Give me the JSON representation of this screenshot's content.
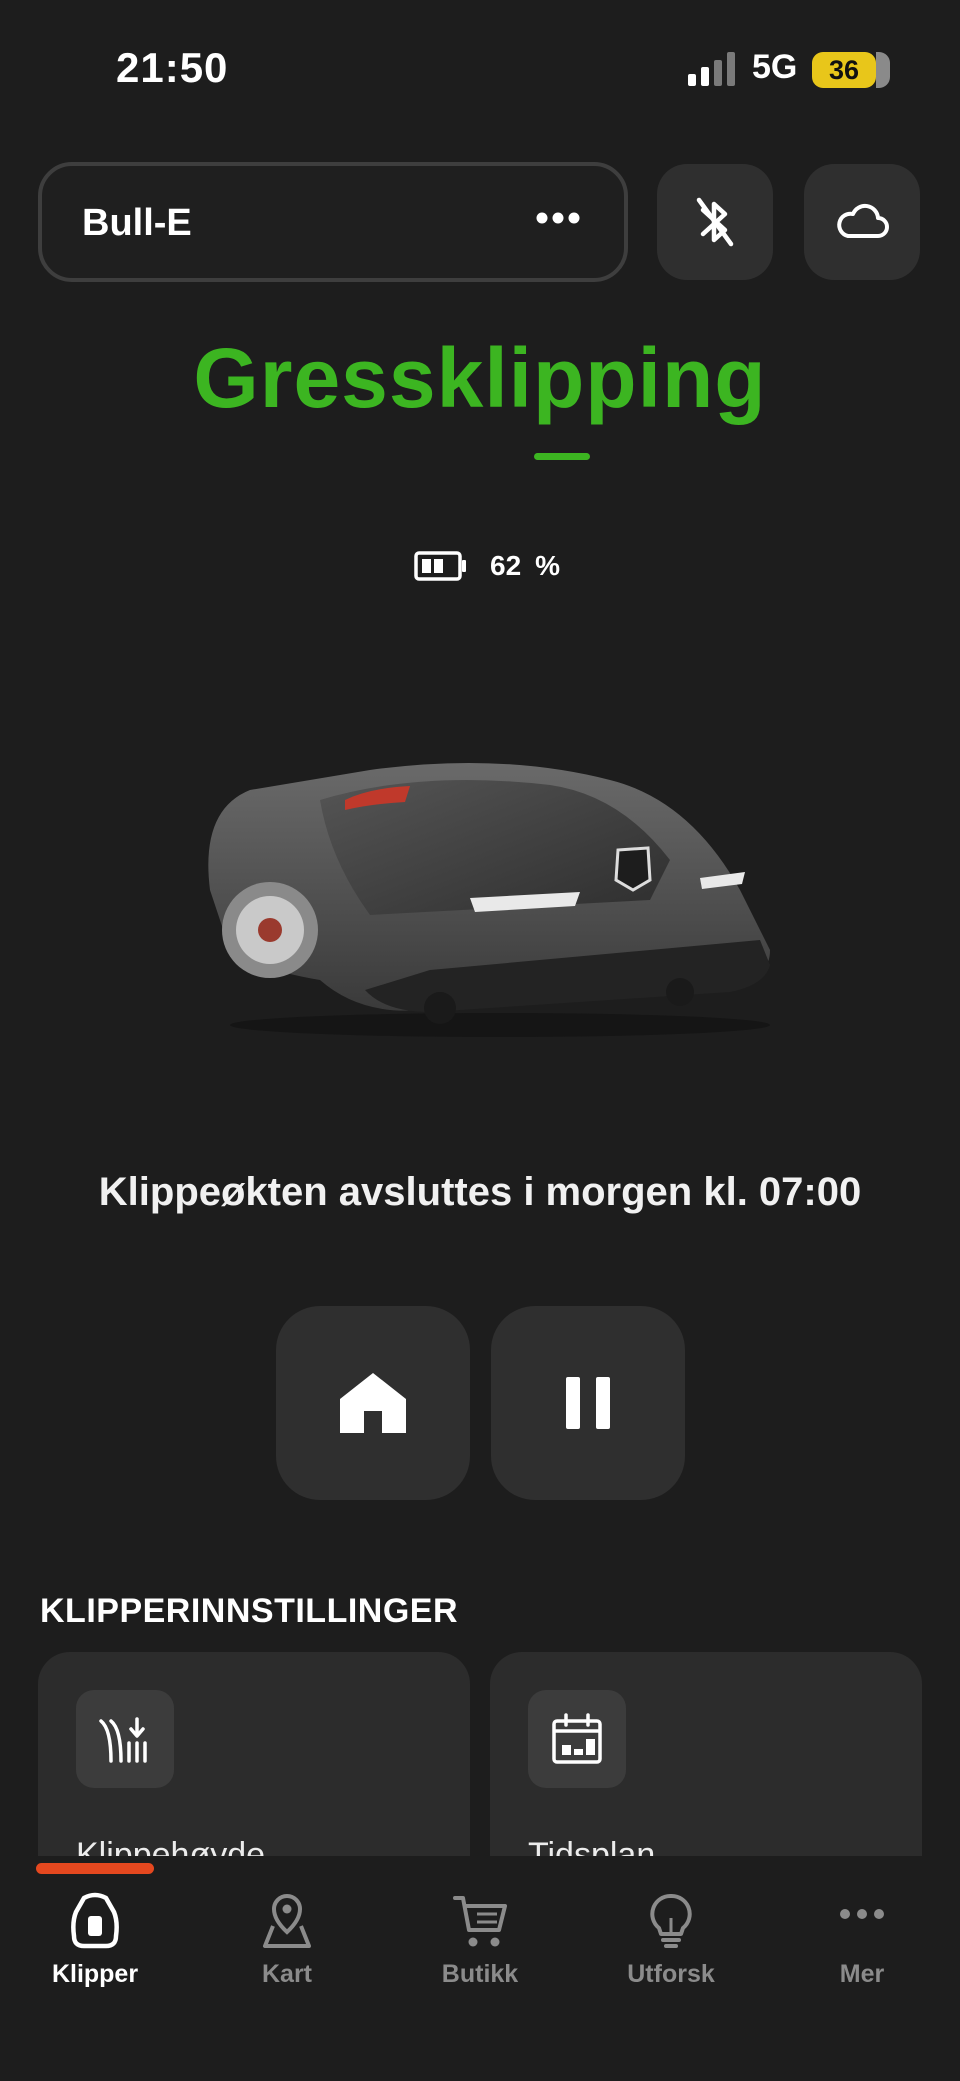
{
  "status_bar": {
    "time": "21:50",
    "network": "5G",
    "battery": "36"
  },
  "header": {
    "device_name": "Bull-E"
  },
  "mode": {
    "title": "Gressklipping"
  },
  "battery": {
    "value": "62",
    "unit": "%",
    "level": 0.62
  },
  "session": {
    "text": "Klippeøkten avsluttes i morgen kl. 07:00"
  },
  "settings": {
    "title": "KLIPPERINNSTILLINGER",
    "cards": [
      {
        "label": "Klippehøyde",
        "icon": "cutting-height-icon"
      },
      {
        "label": "Tidsplan",
        "icon": "calendar-icon"
      }
    ]
  },
  "tabs": [
    {
      "label": "Klipper",
      "icon": "mower-icon",
      "active": true
    },
    {
      "label": "Kart",
      "icon": "map-pin-icon",
      "active": false
    },
    {
      "label": "Butikk",
      "icon": "cart-icon",
      "active": false
    },
    {
      "label": "Utforsk",
      "icon": "lightbulb-icon",
      "active": false
    },
    {
      "label": "Mer",
      "icon": "more-icon",
      "active": false
    }
  ],
  "colors": {
    "accent_green": "#3cb521",
    "tab_indicator": "#e5481f",
    "background": "#1d1d1d",
    "button": "#2f2f2f"
  }
}
